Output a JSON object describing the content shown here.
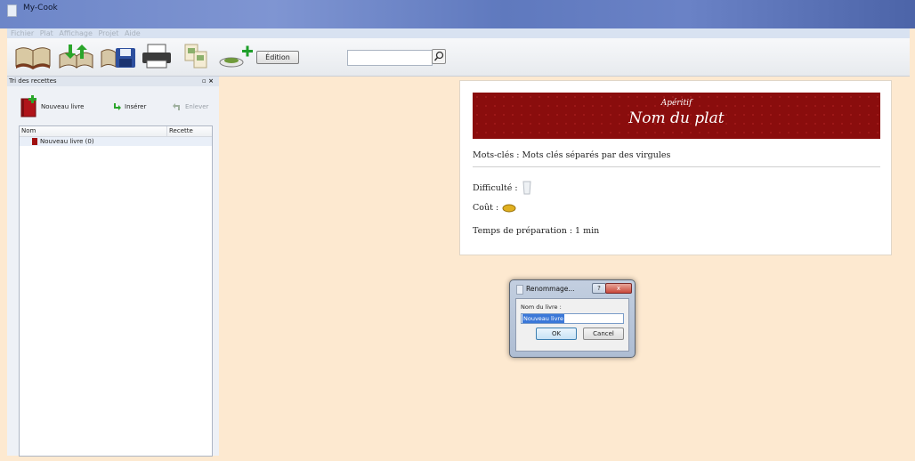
{
  "window": {
    "title": "My-Cook"
  },
  "menu": [
    "Fichier",
    "Plat",
    "Affichage",
    "Projet",
    "Aide"
  ],
  "toolbar": {
    "icons": [
      "open-book-icon",
      "import-export-icon",
      "save-icon",
      "print-icon",
      "recipe-cards-icon",
      "add-dish-icon"
    ],
    "edit_label": "Édition",
    "search_value": ""
  },
  "panel": {
    "title": "Tri des recettes",
    "new_book_label": "Nouveau livre",
    "insert_label": "Insérer",
    "remove_label": "Enlever",
    "columns": [
      "Nom",
      "Recette"
    ],
    "items": [
      {
        "label": "Nouveau livre (0)"
      }
    ]
  },
  "recipe": {
    "category": "Apéritif",
    "dish_name": "Nom du plat",
    "keywords": "Mots-clés : Mots clés séparés par des virgules",
    "difficulty_label": "Difficulté :",
    "cost_label": "Coût :",
    "prep_time": "Temps de préparation : 1 min"
  },
  "dialog": {
    "title": "Renommage...",
    "help": "?",
    "close": "x",
    "field_label": "Nom du livre :",
    "field_value": "Nouveau livre",
    "ok_label": "OK",
    "cancel_label": "Cancel"
  },
  "colors": {
    "banner": "#8a0d0d",
    "background": "#fde9d0",
    "titlebar": "#6d86c8"
  }
}
